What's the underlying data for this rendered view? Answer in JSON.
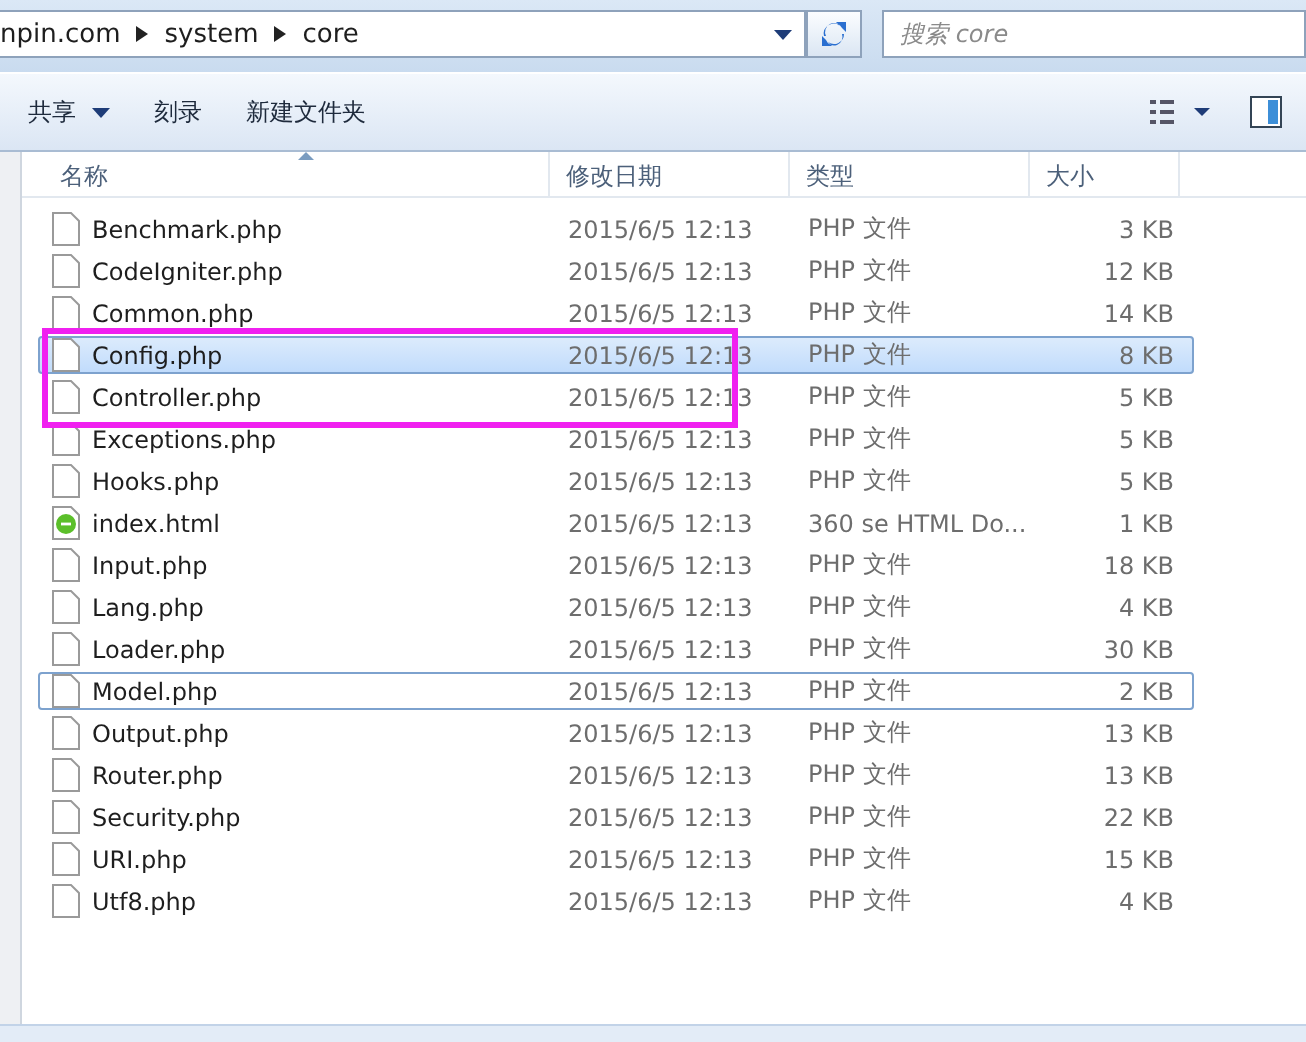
{
  "address_bar": {
    "crumbs": [
      "npin.com",
      "system",
      "core"
    ]
  },
  "search": {
    "placeholder": "搜索 core"
  },
  "toolbar": {
    "buttons": [
      {
        "label": "共享",
        "dropdown": true
      },
      {
        "label": "刻录",
        "dropdown": false
      },
      {
        "label": "新建文件夹",
        "dropdown": false
      }
    ]
  },
  "table": {
    "columns": [
      "名称",
      "修改日期",
      "类型",
      "大小"
    ],
    "rows": [
      {
        "name": "Benchmark.php",
        "kind": "php",
        "date": "2015/6/5 12:13",
        "type": "PHP 文件",
        "size": "3 KB",
        "selected": false,
        "focused": false
      },
      {
        "name": "CodeIgniter.php",
        "kind": "php",
        "date": "2015/6/5 12:13",
        "type": "PHP 文件",
        "size": "12 KB",
        "selected": false,
        "focused": false
      },
      {
        "name": "Common.php",
        "kind": "php",
        "date": "2015/6/5 12:13",
        "type": "PHP 文件",
        "size": "14 KB",
        "selected": false,
        "focused": false
      },
      {
        "name": "Config.php",
        "kind": "php",
        "date": "2015/6/5 12:13",
        "type": "PHP 文件",
        "size": "8 KB",
        "selected": true,
        "focused": false
      },
      {
        "name": "Controller.php",
        "kind": "php",
        "date": "2015/6/5 12:13",
        "type": "PHP 文件",
        "size": "5 KB",
        "selected": false,
        "focused": false
      },
      {
        "name": "Exceptions.php",
        "kind": "php",
        "date": "2015/6/5 12:13",
        "type": "PHP 文件",
        "size": "5 KB",
        "selected": false,
        "focused": false
      },
      {
        "name": "Hooks.php",
        "kind": "php",
        "date": "2015/6/5 12:13",
        "type": "PHP 文件",
        "size": "5 KB",
        "selected": false,
        "focused": false
      },
      {
        "name": "index.html",
        "kind": "html",
        "date": "2015/6/5 12:13",
        "type": "360 se HTML Do...",
        "size": "1 KB",
        "selected": false,
        "focused": false
      },
      {
        "name": "Input.php",
        "kind": "php",
        "date": "2015/6/5 12:13",
        "type": "PHP 文件",
        "size": "18 KB",
        "selected": false,
        "focused": false
      },
      {
        "name": "Lang.php",
        "kind": "php",
        "date": "2015/6/5 12:13",
        "type": "PHP 文件",
        "size": "4 KB",
        "selected": false,
        "focused": false
      },
      {
        "name": "Loader.php",
        "kind": "php",
        "date": "2015/6/5 12:13",
        "type": "PHP 文件",
        "size": "30 KB",
        "selected": false,
        "focused": false
      },
      {
        "name": "Model.php",
        "kind": "php",
        "date": "2015/6/5 12:13",
        "type": "PHP 文件",
        "size": "2 KB",
        "selected": false,
        "focused": true
      },
      {
        "name": "Output.php",
        "kind": "php",
        "date": "2015/6/5 12:13",
        "type": "PHP 文件",
        "size": "13 KB",
        "selected": false,
        "focused": false
      },
      {
        "name": "Router.php",
        "kind": "php",
        "date": "2015/6/5 12:13",
        "type": "PHP 文件",
        "size": "13 KB",
        "selected": false,
        "focused": false
      },
      {
        "name": "Security.php",
        "kind": "php",
        "date": "2015/6/5 12:13",
        "type": "PHP 文件",
        "size": "22 KB",
        "selected": false,
        "focused": false
      },
      {
        "name": "URI.php",
        "kind": "php",
        "date": "2015/6/5 12:13",
        "type": "PHP 文件",
        "size": "15 KB",
        "selected": false,
        "focused": false
      },
      {
        "name": "Utf8.php",
        "kind": "php",
        "date": "2015/6/5 12:13",
        "type": "PHP 文件",
        "size": "4 KB",
        "selected": false,
        "focused": false
      }
    ]
  }
}
